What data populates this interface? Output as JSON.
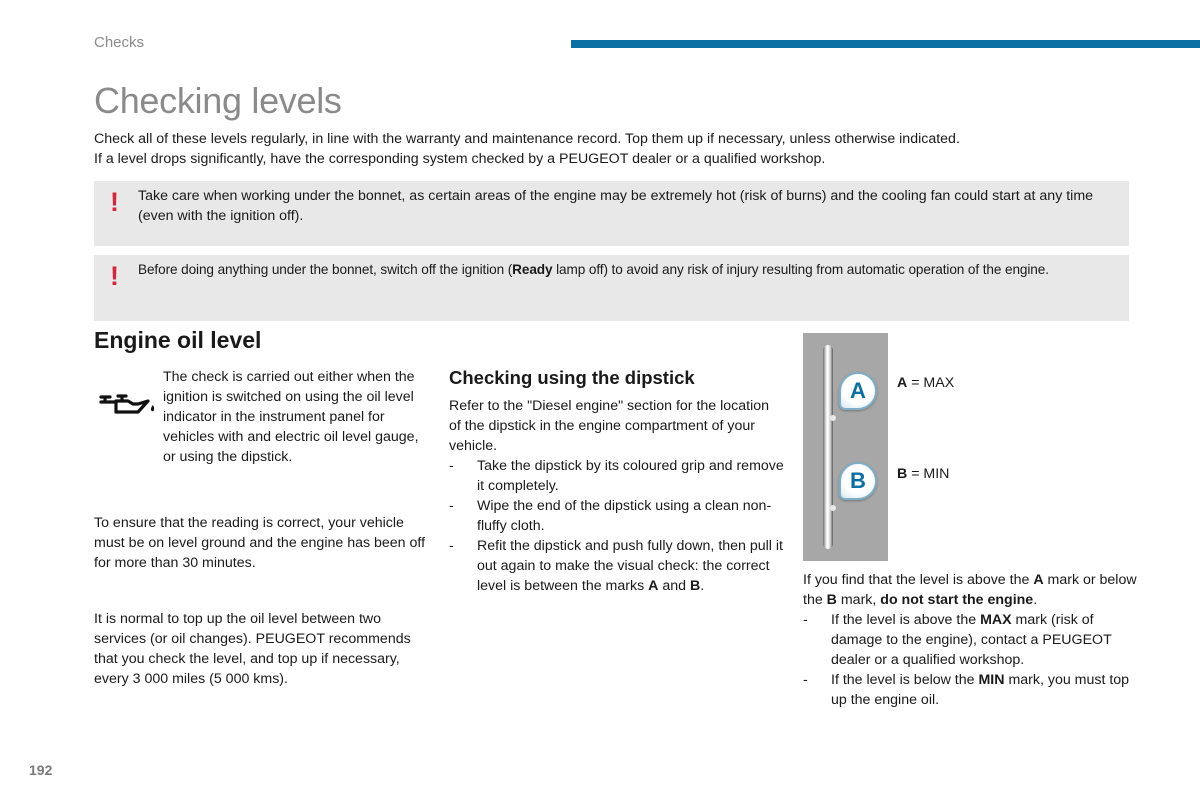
{
  "header": {
    "section_label": "Checks",
    "accent_color": "#0a6fa3"
  },
  "page_title": "Checking levels",
  "intro": {
    "line1": "Check all of these levels regularly, in line with the warranty and maintenance record. Top them up if necessary, unless otherwise indicated.",
    "line2": "If a level drops significantly, have the corresponding system checked by a PEUGEOT dealer or a qualified workshop."
  },
  "warnings": [
    {
      "icon": "exclamation-icon",
      "text": "Take care when working under the bonnet, as certain areas of the engine may be extremely hot (risk of burns) and the cooling fan could start at any time (even with the ignition off)."
    },
    {
      "icon": "exclamation-icon",
      "text_before": "Before doing anything under the bonnet, switch off the ignition (",
      "text_bold": "Ready",
      "text_after": " lamp off) to avoid any risk of injury resulting from automatic operation of the engine."
    }
  ],
  "warning_color": "#d9243a",
  "engine_oil": {
    "heading": "Engine oil level",
    "icon": "oil-can-icon",
    "check_text": "The check is carried out either when the ignition is switched on using the oil level indicator in the instrument panel for vehicles with and electric oil level gauge, or using the dipstick.",
    "ensure_text": "To ensure that the reading is correct, your vehicle must be on level ground and the engine has been off for more than 30 minutes.",
    "normal_text": "It is normal to top up the oil level between two services (or oil changes). PEUGEOT recommends that you check the level, and top up if necessary, every 3 000 miles (5 000 kms)."
  },
  "dipstick": {
    "heading": "Checking using the dipstick",
    "refer_text": "Refer to the \"Diesel engine\" section for the location of the dipstick in the engine compartment of your vehicle.",
    "steps": [
      {
        "text": "Take the dipstick by its coloured grip and remove it completely."
      },
      {
        "text": "Wipe the end of the dipstick using a clean non-fluffy cloth."
      },
      {
        "text_before": "Refit the dipstick and push fully down, then pull it out again to make the visual check: the correct level is between the marks ",
        "bold1": "A",
        "middle": " and ",
        "bold2": "B",
        "text_after": "."
      }
    ],
    "dash": "-"
  },
  "diagram": {
    "mark_a": "A",
    "mark_b": "B",
    "legend_a_letter": "A",
    "legend_a_text": " = MAX",
    "legend_b_letter": "B",
    "legend_b_text": " = MIN"
  },
  "levels": {
    "intro_1": "If you find that the level is above the ",
    "intro_bold_a": "A",
    "intro_2": " mark or below the ",
    "intro_bold_b": "B",
    "intro_3": " mark, ",
    "intro_bold_warn": "do not start the engine",
    "intro_4": ".",
    "items": [
      {
        "before": "If the level is above the ",
        "bold": "MAX",
        "after": " mark (risk of damage to the engine), contact a PEUGEOT dealer or a qualified workshop."
      },
      {
        "before": "If the level is below the ",
        "bold": "MIN",
        "after": " mark, you must top up the engine oil."
      }
    ]
  },
  "page_number": "192"
}
